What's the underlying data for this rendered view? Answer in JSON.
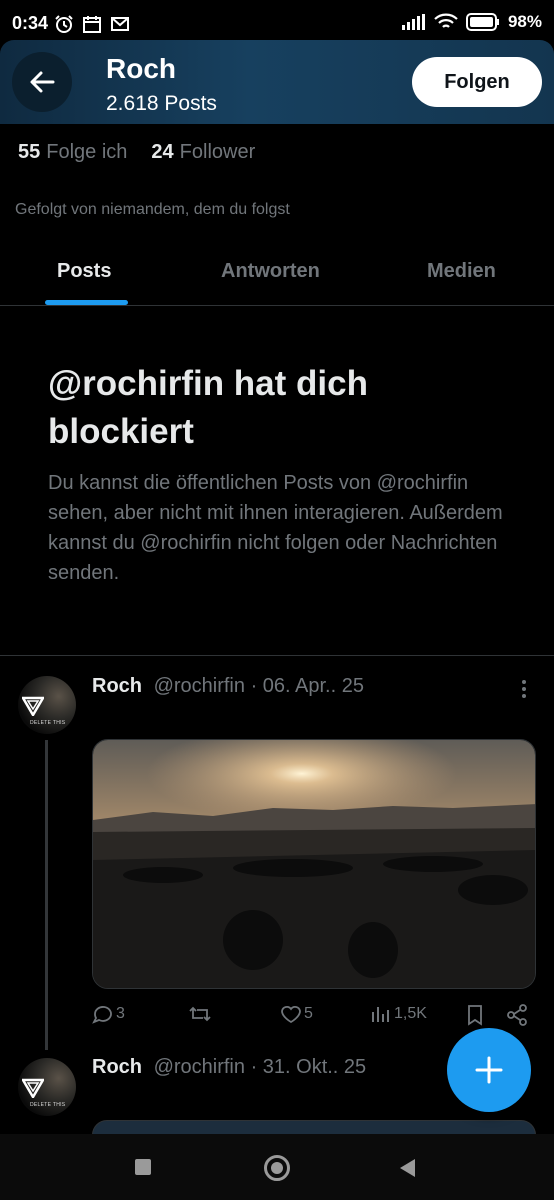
{
  "status_bar": {
    "time": "0:34",
    "battery": "98%",
    "icons_left": [
      "alarm-icon",
      "calendar-icon",
      "mail-icon"
    ],
    "icons_right": [
      "signal-icon",
      "wifi-icon",
      "battery-icon"
    ]
  },
  "header": {
    "name": "Roch",
    "posts_count": "2.618 Posts",
    "follow_label": "Folgen"
  },
  "stats": {
    "following_count": "55",
    "following_label": "Folge ich",
    "followers_count": "24",
    "followers_label": "Follower"
  },
  "followed_by": "Gefolgt von niemandem, dem du folgst",
  "tabs": [
    {
      "label": "Posts",
      "active": true
    },
    {
      "label": "Antworten",
      "active": false
    },
    {
      "label": "Medien",
      "active": false
    }
  ],
  "blocked": {
    "title": "@rochirfin hat dich blockiert",
    "body": "Du kannst die öffentlichen Posts von @rochirfin sehen, aber nicht mit ihnen interagieren. Außerdem kannst du @rochirfin nicht folgen oder Nachrichten senden."
  },
  "posts": [
    {
      "name": "Roch",
      "handle": "@rochirfin",
      "date": "· 06. Apr.. 25",
      "avatar_text": "DELETE THIS",
      "replies": "3",
      "reposts": "",
      "likes": "5",
      "views": "1,5K"
    },
    {
      "name": "Roch",
      "handle": "@rochirfin",
      "date": "· 31. Okt.. 25",
      "avatar_text": "DELETE THIS"
    }
  ],
  "colors": {
    "accent": "#1d9bf0",
    "header_bg": "#17405f",
    "muted_text": "#71767b"
  }
}
